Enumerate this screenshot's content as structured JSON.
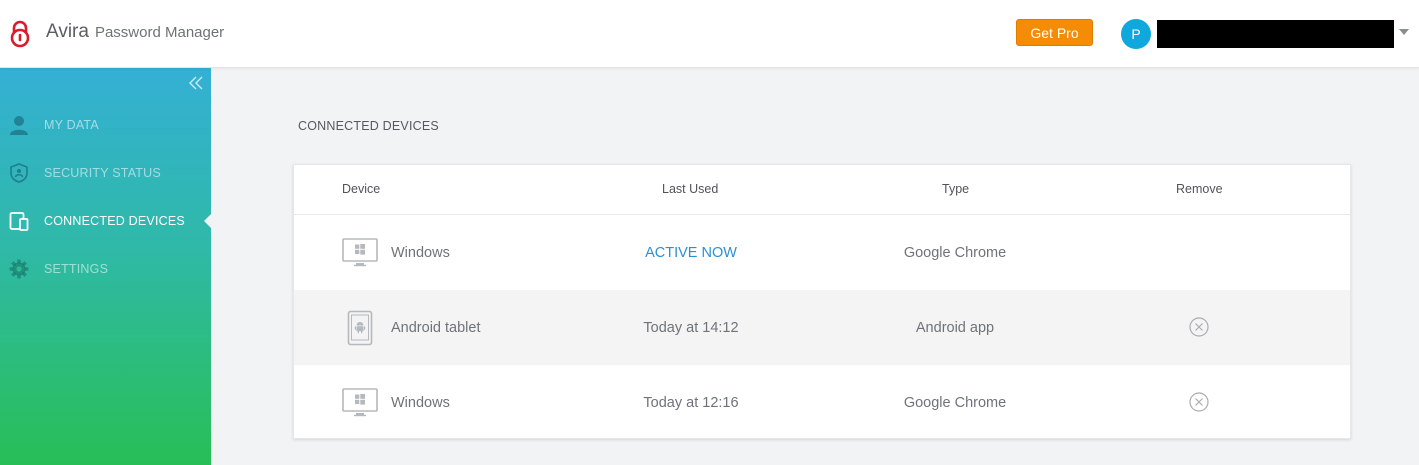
{
  "header": {
    "brand_main": "Avira",
    "brand_sub": "Password Manager",
    "get_pro_label": "Get Pro",
    "avatar_initial": "P",
    "accent_color": "#f48c06"
  },
  "sidebar": {
    "items": [
      {
        "label": "MY DATA",
        "icon": "person-icon"
      },
      {
        "label": "SECURITY STATUS",
        "icon": "shield-icon"
      },
      {
        "label": "CONNECTED DEVICES",
        "icon": "devices-icon",
        "active": true
      },
      {
        "label": "SETTINGS",
        "icon": "gear-icon"
      }
    ]
  },
  "main": {
    "section_title": "CONNECTED DEVICES",
    "table": {
      "columns": [
        "Device",
        "Last Used",
        "Type",
        "Remove"
      ],
      "rows": [
        {
          "device": "Windows",
          "last_used": "ACTIVE NOW",
          "type": "Google Chrome",
          "icon": "monitor-windows-icon",
          "removable": false
        },
        {
          "device": "Android tablet",
          "last_used": "Today at 14:12",
          "type": "Android app",
          "icon": "tablet-android-icon",
          "removable": true
        },
        {
          "device": "Windows",
          "last_used": "Today at 12:16",
          "type": "Google Chrome",
          "icon": "monitor-windows-icon",
          "removable": true
        }
      ]
    }
  }
}
